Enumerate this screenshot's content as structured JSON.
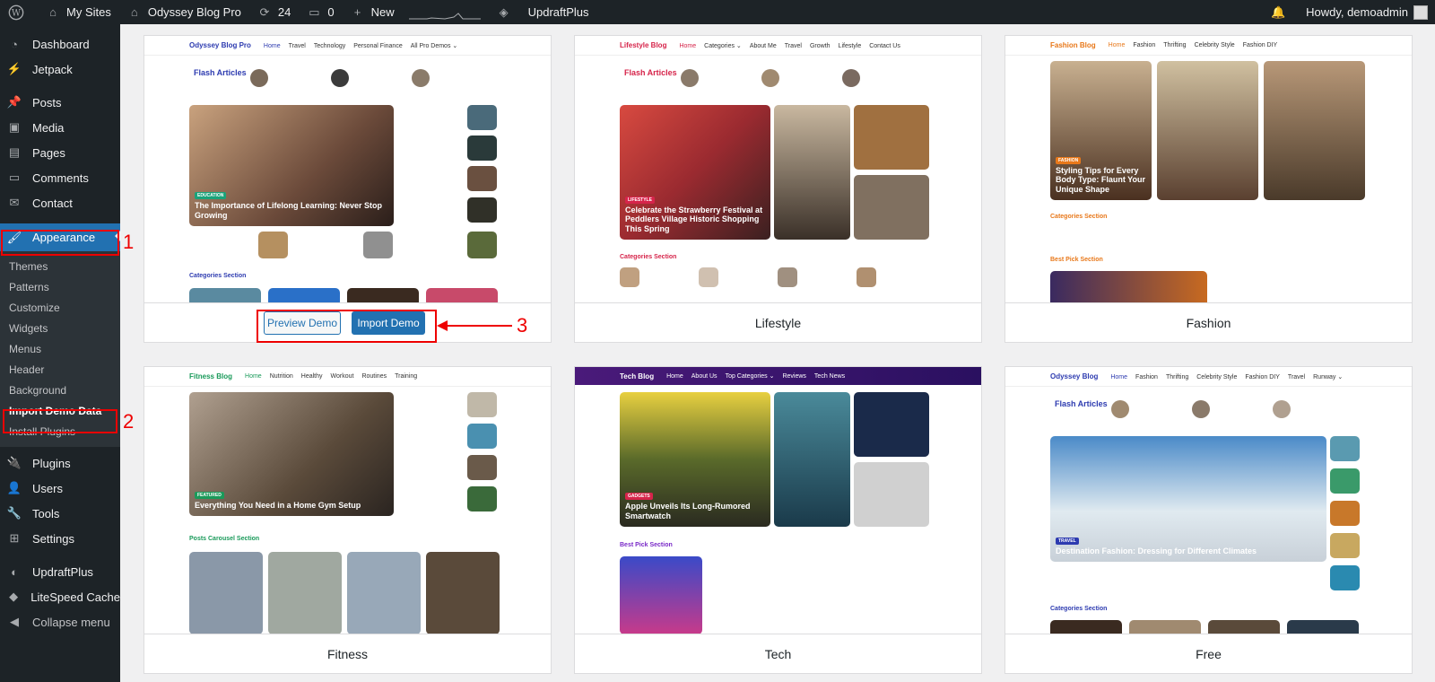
{
  "adminbar": {
    "site": "My Sites",
    "blog": "Odyssey Blog Pro",
    "updates": "24",
    "comments": "0",
    "new": "New",
    "updraft": "UpdraftPlus",
    "howdy": "Howdy, demoadmin"
  },
  "menu": {
    "items": [
      "Dashboard",
      "Jetpack",
      "Posts",
      "Media",
      "Pages",
      "Comments",
      "Contact",
      "Appearance"
    ],
    "sub": [
      "Themes",
      "Patterns",
      "Customize",
      "Widgets",
      "Menus",
      "Header",
      "Background",
      "Import Demo Data",
      "Install Plugins"
    ],
    "items2": [
      "Plugins",
      "Users",
      "Tools",
      "Settings",
      "UpdraftPlus",
      "LiteSpeed Cache",
      "Collapse menu"
    ]
  },
  "callouts": {
    "n1": "1",
    "n2": "2",
    "n3": "3"
  },
  "cards": [
    {
      "name": "",
      "logo": "Odyssey Blog Pro",
      "nav": [
        "Home",
        "Travel",
        "Technology",
        "Personal Finance",
        "All Pro Demos ⌄"
      ],
      "flash": "Flash Articles",
      "hero": "The Importance of Lifelong Learning: Never Stop Growing",
      "section": "Categories Section",
      "preview": "Preview Demo",
      "import": "Import Demo"
    },
    {
      "name": "Lifestyle",
      "logo": "Lifestyle Blog",
      "nav": [
        "Home",
        "Categories ⌄",
        "About Me",
        "Travel",
        "Growth",
        "Lifestyle",
        "Contact Us"
      ],
      "flash": "Flash Articles",
      "hero": "Celebrate the Strawberry Festival at Peddlers Village Historic Shopping This Spring",
      "section": "Categories Section"
    },
    {
      "name": "Fashion",
      "logo": "Fashion Blog",
      "nav": [
        "Home",
        "Fashion",
        "Thrifting",
        "Celebrity Style",
        "Fashion DIY"
      ],
      "hero": "Styling Tips for Every Body Type: Flaunt Your Unique Shape",
      "section": "Categories Section",
      "section2": "Best Pick Section"
    },
    {
      "name": "Fitness",
      "logo": "Fitness Blog",
      "nav": [
        "Home",
        "Nutrition",
        "Healthy",
        "Workout",
        "Routines",
        "Training"
      ],
      "hero": "Everything You Need in a Home Gym Setup",
      "section": "Posts Carousel Section"
    },
    {
      "name": "Tech",
      "logo": "Tech Blog",
      "nav": [
        "Home",
        "About Us",
        "Top Categories ⌄",
        "Reviews",
        "Tech News"
      ],
      "hero": "Apple Unveils Its Long-Rumored Smartwatch",
      "section": "Best Pick Section"
    },
    {
      "name": "Free",
      "logo": "Odyssey Blog",
      "nav": [
        "Home",
        "Fashion",
        "Thrifting",
        "Celebrity Style",
        "Fashion DIY",
        "Travel",
        "Runway ⌄"
      ],
      "flash": "Flash Articles",
      "hero": "Destination Fashion: Dressing for Different Climates",
      "section": "Categories Section"
    }
  ]
}
